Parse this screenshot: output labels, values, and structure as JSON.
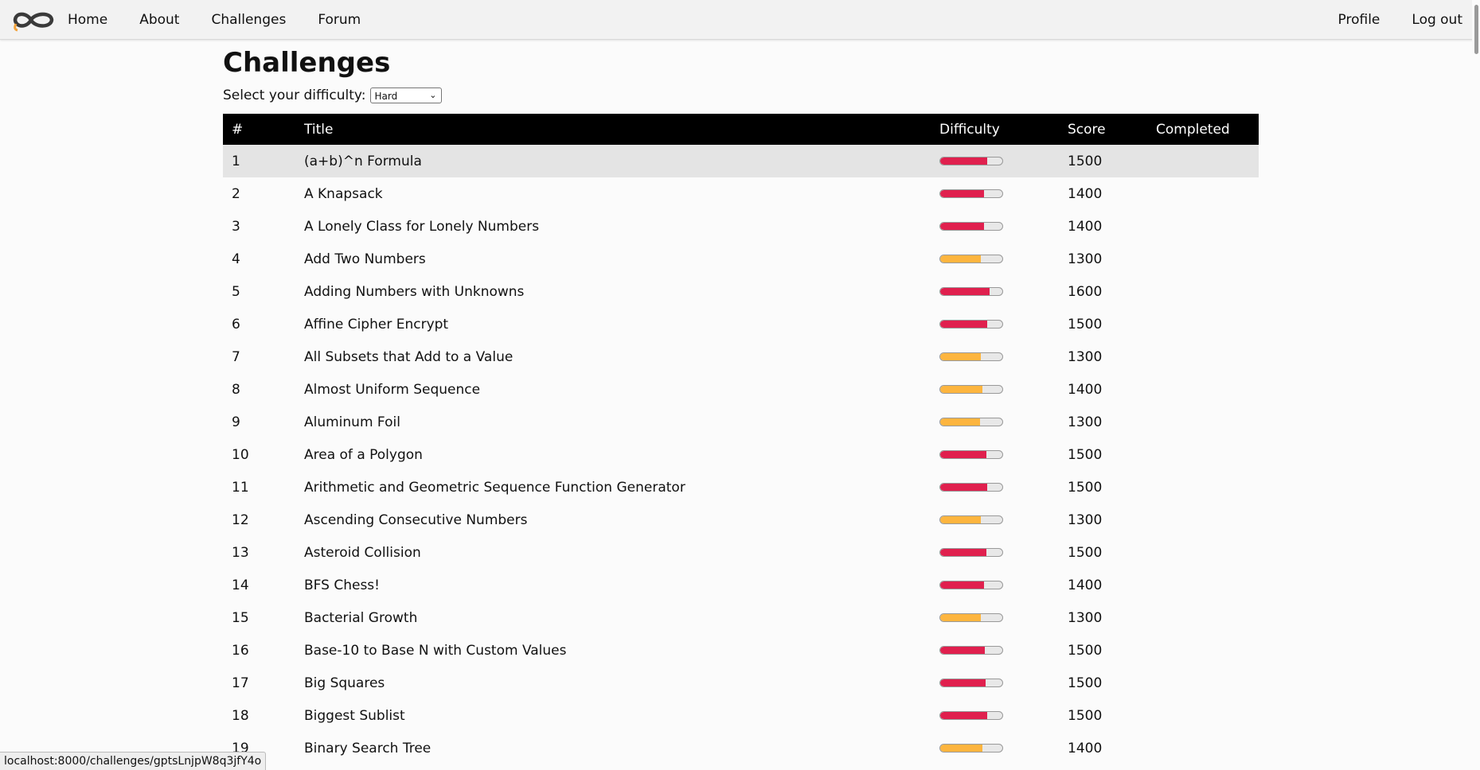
{
  "nav": {
    "logo_name": "infinity-logo",
    "links": [
      "Home",
      "About",
      "Challenges",
      "Forum"
    ],
    "right_links": [
      "Profile",
      "Log out"
    ]
  },
  "page": {
    "title": "Challenges",
    "difficulty_label": "Select your difficulty:",
    "difficulty_selected": "Hard"
  },
  "table": {
    "headers": [
      "#",
      "Title",
      "Difficulty",
      "Score",
      "Completed"
    ],
    "rows": [
      {
        "num": "1",
        "title": "(a+b)^n Formula",
        "difficulty": 0.76,
        "color": "#e0204e",
        "score": "1500",
        "completed": ""
      },
      {
        "num": "2",
        "title": "A Knapsack",
        "difficulty": 0.7,
        "color": "#e0204e",
        "score": "1400",
        "completed": ""
      },
      {
        "num": "3",
        "title": "A Lonely Class for Lonely Numbers",
        "difficulty": 0.7,
        "color": "#e0204e",
        "score": "1400",
        "completed": ""
      },
      {
        "num": "4",
        "title": "Add Two Numbers",
        "difficulty": 0.66,
        "color": "#fdb53f",
        "score": "1300",
        "completed": ""
      },
      {
        "num": "5",
        "title": "Adding Numbers with Unknowns",
        "difficulty": 0.79,
        "color": "#e0204e",
        "score": "1600",
        "completed": ""
      },
      {
        "num": "6",
        "title": "Affine Cipher Encrypt",
        "difficulty": 0.76,
        "color": "#e0204e",
        "score": "1500",
        "completed": ""
      },
      {
        "num": "7",
        "title": "All Subsets that Add to a Value",
        "difficulty": 0.66,
        "color": "#fdb53f",
        "score": "1300",
        "completed": ""
      },
      {
        "num": "8",
        "title": "Almost Uniform Sequence",
        "difficulty": 0.68,
        "color": "#fdb53f",
        "score": "1400",
        "completed": ""
      },
      {
        "num": "9",
        "title": "Aluminum Foil",
        "difficulty": 0.64,
        "color": "#fdb53f",
        "score": "1300",
        "completed": ""
      },
      {
        "num": "10",
        "title": "Area of a Polygon",
        "difficulty": 0.74,
        "color": "#e0204e",
        "score": "1500",
        "completed": ""
      },
      {
        "num": "11",
        "title": "Arithmetic and Geometric Sequence Function Generator",
        "difficulty": 0.75,
        "color": "#e0204e",
        "score": "1500",
        "completed": ""
      },
      {
        "num": "12",
        "title": "Ascending Consecutive Numbers",
        "difficulty": 0.65,
        "color": "#fdb53f",
        "score": "1300",
        "completed": ""
      },
      {
        "num": "13",
        "title": "Asteroid Collision",
        "difficulty": 0.74,
        "color": "#e0204e",
        "score": "1500",
        "completed": ""
      },
      {
        "num": "14",
        "title": "BFS Chess!",
        "difficulty": 0.7,
        "color": "#e0204e",
        "score": "1400",
        "completed": ""
      },
      {
        "num": "15",
        "title": "Bacterial Growth",
        "difficulty": 0.66,
        "color": "#fdb53f",
        "score": "1300",
        "completed": ""
      },
      {
        "num": "16",
        "title": "Base-10 to Base N with Custom Values",
        "difficulty": 0.72,
        "color": "#e0204e",
        "score": "1500",
        "completed": ""
      },
      {
        "num": "17",
        "title": "Big Squares",
        "difficulty": 0.73,
        "color": "#e0204e",
        "score": "1500",
        "completed": ""
      },
      {
        "num": "18",
        "title": "Biggest Sublist",
        "difficulty": 0.75,
        "color": "#e0204e",
        "score": "1500",
        "completed": ""
      },
      {
        "num": "19",
        "title": "Binary Search Tree",
        "difficulty": 0.68,
        "color": "#fdb53f",
        "score": "1400",
        "completed": ""
      }
    ]
  },
  "status_url": "localhost:8000/challenges/gptsLnjpW8q3jfY4o"
}
